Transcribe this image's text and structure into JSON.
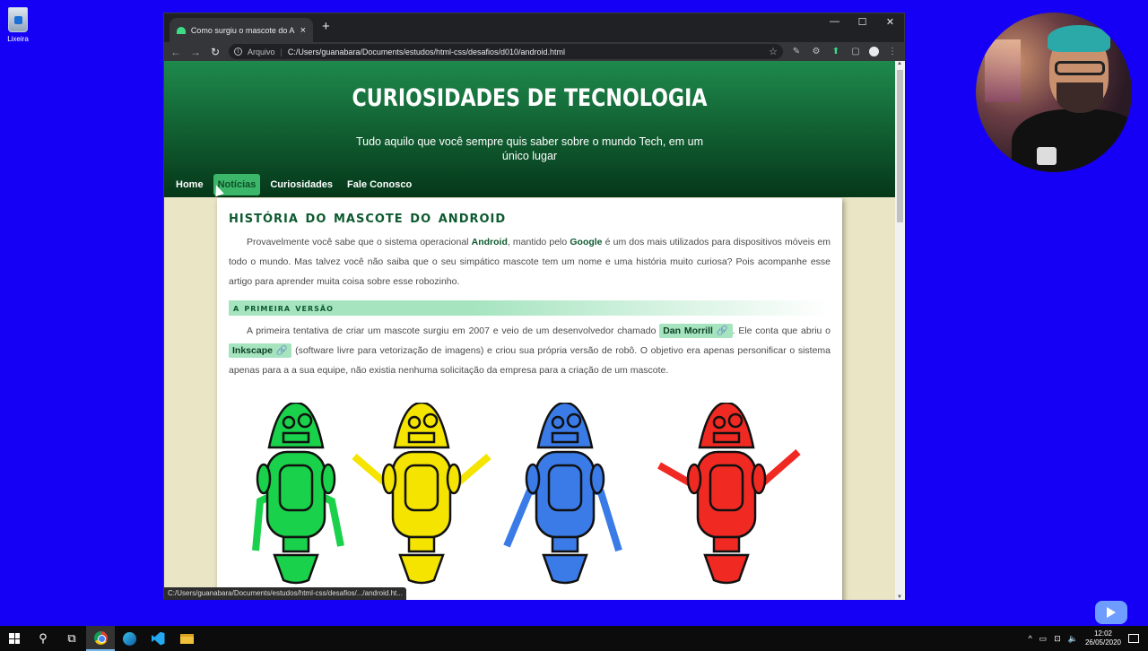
{
  "desktop": {
    "recycle_label": "Lixeira"
  },
  "browser": {
    "tab_title": "Como surgiu o mascote do Andr",
    "tab_close": "×",
    "new_tab": "+",
    "window_controls": [
      "—",
      "☐",
      "✕"
    ],
    "back": "←",
    "forward": "→",
    "reload": "↻",
    "scheme_label": "Arquivo",
    "url": "C:/Users/guanabara/Documents/estudos/html-css/desafios/d010/android.html",
    "bookmark_star": "☆",
    "status_url": "C:/Users/guanabara/Documents/estudos/html-css/desafios/.../android.ht..."
  },
  "site": {
    "title": "Curiosidades de Tecnologia",
    "subtitle": "Tudo aquilo que você sempre quis saber sobre o mundo Tech, em um único lugar",
    "nav": [
      "Home",
      "Notícias",
      "Curiosidades",
      "Fale Conosco"
    ]
  },
  "article": {
    "heading": "História do mascote do Android",
    "p1": {
      "a": "Provavelmente você sabe que o sistema operacional ",
      "b1": "Android",
      "c": ", mantido pelo ",
      "b2": "Google",
      "d": " é um dos mais utilizados para dispositivos móveis em todo o mundo. Mas talvez você não saiba que o seu simpático mascote tem um nome e uma história muito curiosa? Pois acompanhe esse artigo para aprender muita coisa sobre esse robozinho."
    },
    "section1": "A primeira versão",
    "p2": {
      "a": "A primeira tentativa de criar um mascote surgiu em 2007 e veio de um desenvolvedor chamado ",
      "link1": "Dan Morrill",
      "b": ". Ele conta que abriu o ",
      "link2": "Inkscape",
      "c": " (software livre para vetorização de imagens) e criou sua própria versão de robô. O objetivo era apenas personificar o sistema apenas para a a sua equipe, não existia nenhuma solicitação da empresa para a criação de um mascote."
    },
    "link_icon": "🔗",
    "robots": [
      {
        "color": "#19d14a"
      },
      {
        "color": "#f4e400"
      },
      {
        "color": "#3a7be8"
      },
      {
        "color": "#f02a22"
      }
    ]
  },
  "taskbar": {
    "clock_time": "12:02",
    "clock_date": "26/05/2020"
  }
}
